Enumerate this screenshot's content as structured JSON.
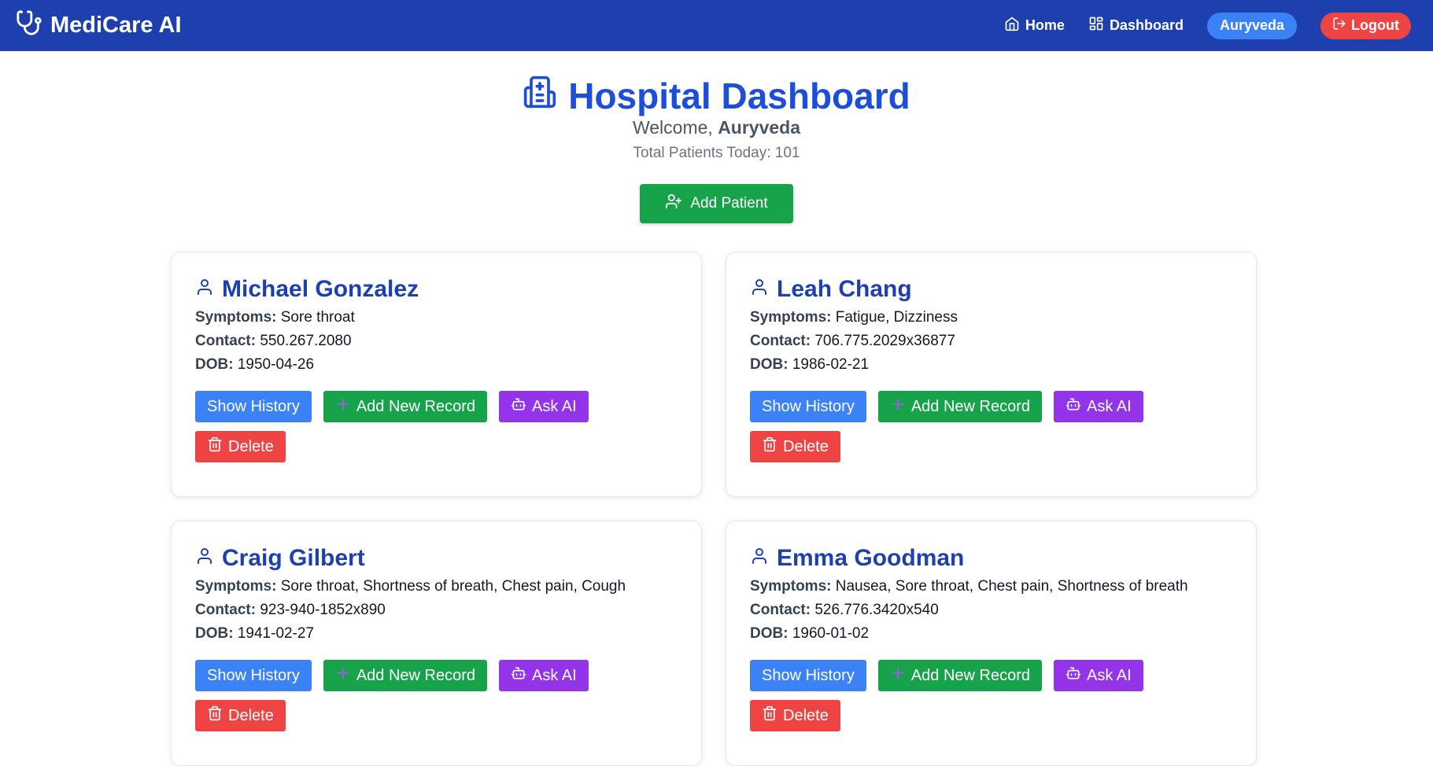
{
  "nav": {
    "brand": "MediCare AI",
    "home": "Home",
    "dashboard": "Dashboard",
    "user": "Auryveda",
    "logout": "Logout"
  },
  "header": {
    "title": "Hospital Dashboard",
    "welcome_prefix": "Welcome,",
    "welcome_name": "Auryveda",
    "total": "Total Patients Today: 101"
  },
  "add_patient_label": "Add Patient",
  "labels": {
    "symptoms": "Symptoms:",
    "contact": "Contact:",
    "dob": "DOB:",
    "show_history": "Show History",
    "add_record": "Add New Record",
    "ask_ai": "Ask AI",
    "delete": "Delete"
  },
  "patients": [
    {
      "name": "Michael Gonzalez",
      "symptoms": "Sore throat",
      "contact": "550.267.2080",
      "dob": "1950-04-26"
    },
    {
      "name": "Leah Chang",
      "symptoms": "Fatigue, Dizziness",
      "contact": "706.775.2029x36877",
      "dob": "1986-02-21"
    },
    {
      "name": "Craig Gilbert",
      "symptoms": "Sore throat, Shortness of breath, Chest pain, Cough",
      "contact": "923-940-1852x890",
      "dob": "1941-02-27"
    },
    {
      "name": "Emma Goodman",
      "symptoms": "Nausea, Sore throat, Chest pain, Shortness of breath",
      "contact": "526.776.3420x540",
      "dob": "1960-01-02"
    }
  ]
}
